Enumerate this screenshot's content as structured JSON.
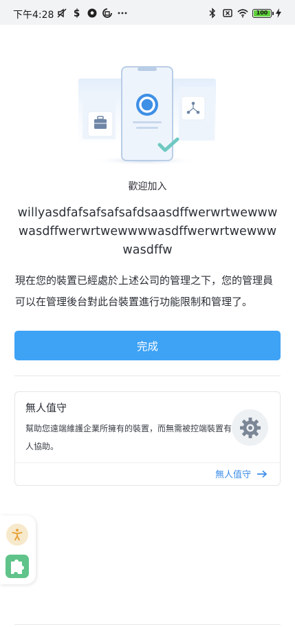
{
  "status_bar": {
    "time": "下午4:28",
    "left_icons": [
      "mute-icon",
      "sync-icon",
      "soccer-icon",
      "app-icon",
      "more-icon"
    ],
    "right_icons": [
      "bluetooth-icon",
      "no-sim-icon",
      "wifi-icon"
    ],
    "battery": "100"
  },
  "main": {
    "welcome": "歡迎加入",
    "company_name": "willyasdfafsafsafsafdsaasdffwerwrtwewwwwasdffwerwrtwewwwwasdffwerwrtwewwwwasdffw",
    "description": "現在您的裝置已經處於上述公司的管理之下，您的管理員可以在管理後台對此台裝置進行功能限制和管理了。",
    "done_button": "完成"
  },
  "unattended_card": {
    "title": "無人值守",
    "description": "幫助您遠端維護企業所擁有的裝置，而無需被控端裝置有人協助。",
    "link_label": "無人值守",
    "icon": "gear-icon"
  },
  "floating_widget": {
    "icons": [
      "accessibility-icon",
      "puzzle-icon"
    ]
  },
  "colors": {
    "primary": "#3ea2f5",
    "link": "#3e8ee8",
    "text": "#2b2f36",
    "accessibility_bg": "#f7e9cc",
    "puzzle": "#5fc38a"
  }
}
